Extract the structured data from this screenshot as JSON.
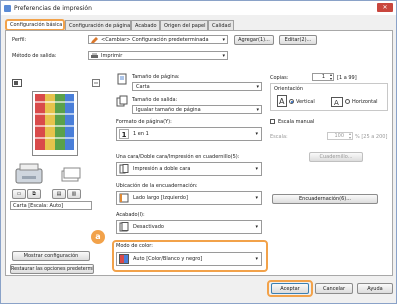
{
  "window": {
    "title": "Preferencias de impresión"
  },
  "tabs": [
    {
      "label": "Configuración básica",
      "active": true
    },
    {
      "label": "Configuración de página",
      "active": false
    },
    {
      "label": "Acabado",
      "active": false
    },
    {
      "label": "Origen del papel",
      "active": false
    },
    {
      "label": "Calidad",
      "active": false
    }
  ],
  "profile": {
    "label": "Perfil:",
    "value": "<Cambiar> Configuración predeterminada",
    "add_label": "Agregar(1)...",
    "edit_label": "Editar(2)..."
  },
  "output": {
    "label": "Método de salida:",
    "value": "Imprimir"
  },
  "preview": {
    "caption": "Carta [Escala: Auto]",
    "show_settings": "Mostrar configuración",
    "restore_defaults": "Restaurar las opciones predeterminadas"
  },
  "page_size": {
    "label": "Tamaño de página:",
    "value": "Carta"
  },
  "output_size": {
    "label": "Tamaño de salida:",
    "value": "Igualar tamaño de página"
  },
  "copies": {
    "label": "Copias:",
    "value": "1",
    "range": "[1 a 99]"
  },
  "orientation": {
    "label": "Orientación",
    "vertical": "Vertical",
    "horizontal": "Horizontal",
    "selected": "vertical"
  },
  "page_layout": {
    "label": "Formato de página(Y):",
    "value": "1 en 1"
  },
  "manual_scale": {
    "label": "Escala manual",
    "scale_label": "Escala:",
    "scale_value": "100",
    "scale_range": "% [25 a 200]"
  },
  "duplex": {
    "label": "Una cara/Doble cara/Impresión en cuadernillo(5):",
    "value": "Impresión a doble cara",
    "booklet_label": "Cuadernillo..."
  },
  "binding": {
    "label": "Ubicación de la encuadernación:",
    "value": "Lado largo [Izquierdo]",
    "binding_btn": "Encuadernación(6)..."
  },
  "finishing": {
    "label": "Acabado(I):",
    "value": "Desactivado"
  },
  "color_mode": {
    "label": "Modo de color:",
    "value": "Auto [Color/Blanco y negro]",
    "badge": "a"
  },
  "footer": {
    "ok": "Aceptar",
    "cancel": "Cancelar",
    "help": "Ayuda"
  },
  "colors": {
    "accent": "#f2a24a"
  }
}
